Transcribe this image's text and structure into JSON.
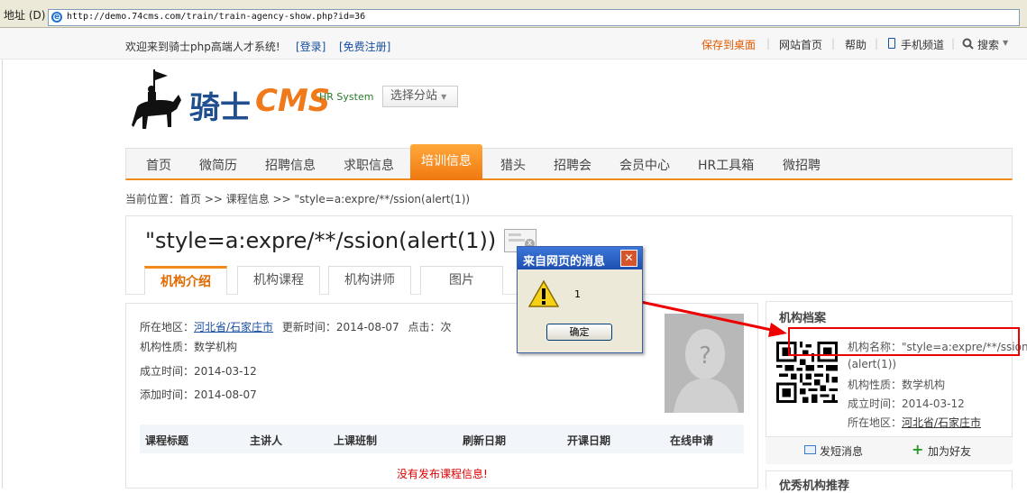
{
  "browser": {
    "address_label": "地址 (D)",
    "url": "http://demo.74cms.com/train/train-agency-show.php?id=36"
  },
  "topbar": {
    "welcome": "欢迎来到骑士php高端人才系统!",
    "login": "[登录]",
    "register": "[免费注册]",
    "save_desktop": "保存到桌面",
    "home": "网站首页",
    "help": "帮助",
    "mobile": "手机频道",
    "search": "搜索"
  },
  "logo": {
    "text": "骑士",
    "cms": "CMS",
    "tagline": "HR System"
  },
  "site_select": "选择分站",
  "nav": {
    "items": [
      "首页",
      "微简历",
      "招聘信息",
      "求职信息",
      "培训信息",
      "猎头",
      "招聘会",
      "会员中心",
      "HR工具箱",
      "微招聘"
    ],
    "active": "培训信息"
  },
  "breadcrumb": "当前位置：首页 >> 课程信息 >> \"style=a:expre/**/ssion(alert(1))",
  "main": {
    "title": "\"style=a:expre/**/ssion(alert(1))",
    "tabs": [
      "机构介绍",
      "机构课程",
      "机构讲师",
      "图片"
    ],
    "info": {
      "region_label": "所在地区：",
      "region": "河北省/石家庄市",
      "updated_label": "更新时间：",
      "updated": "2014-08-07",
      "clicks_label": "点击：",
      "clicks_suffix": "次",
      "type": "机构性质：数学机构",
      "founded": "成立时间：2014-03-12",
      "added": "添加时间：2014-08-07"
    },
    "table_headers": [
      "课程标题",
      "主讲人",
      "上课班制",
      "刷新日期",
      "开课日期",
      "在线申请"
    ],
    "empty_message": "没有发布课程信息!"
  },
  "sidebar": {
    "heading": "机构档案",
    "name_line1": "机构名称：\"style=a:expre/**/ssion",
    "name_line2": "(alert(1))",
    "type": "机构性质：数学机构",
    "founded": "成立时间：2014-03-12",
    "region_label": "所在地区：",
    "region": "河北省/石家庄市",
    "send_message": "发短消息",
    "add_friend": "加为好友",
    "recommend_heading": "优秀机构推荐"
  },
  "dialog": {
    "title": "来自网页的消息",
    "message": "1",
    "ok": "确定"
  },
  "colors": {
    "accent": "#f08a1a",
    "brand_blue": "#1f4f8f",
    "annotation_red": "#e00000"
  }
}
